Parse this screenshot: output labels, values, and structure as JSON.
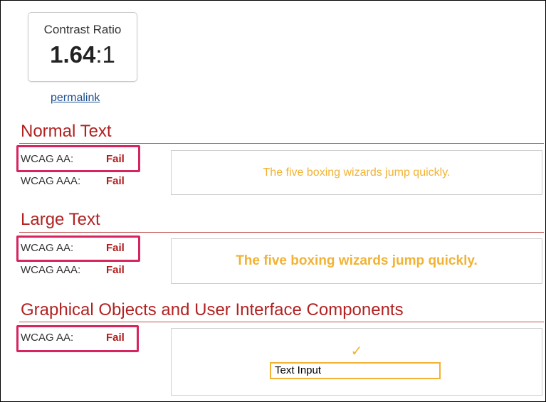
{
  "contrast": {
    "title": "Contrast Ratio",
    "ratio_value": "1.64",
    "ratio_suffix": ":1"
  },
  "permalink_label": "permalink",
  "sections": {
    "normal_text": {
      "title": "Normal Text",
      "aa_label": "WCAG AA:",
      "aa_result": "Fail",
      "aaa_label": "WCAG AAA:",
      "aaa_result": "Fail",
      "sample": "The five boxing wizards jump quickly."
    },
    "large_text": {
      "title": "Large Text",
      "aa_label": "WCAG AA:",
      "aa_result": "Fail",
      "aaa_label": "WCAG AAA:",
      "aaa_result": "Fail",
      "sample": "The five boxing wizards jump quickly."
    },
    "graphical": {
      "title": "Graphical Objects and User Interface Components",
      "aa_label": "WCAG AA:",
      "aa_result": "Fail",
      "check_glyph": "✓",
      "input_value": "Text Input"
    }
  },
  "colors": {
    "heading": "#b22222",
    "fail": "#b01c1c",
    "sample_foreground": "#f2b233",
    "highlight": "#d6245e",
    "link": "#1d4f91"
  }
}
